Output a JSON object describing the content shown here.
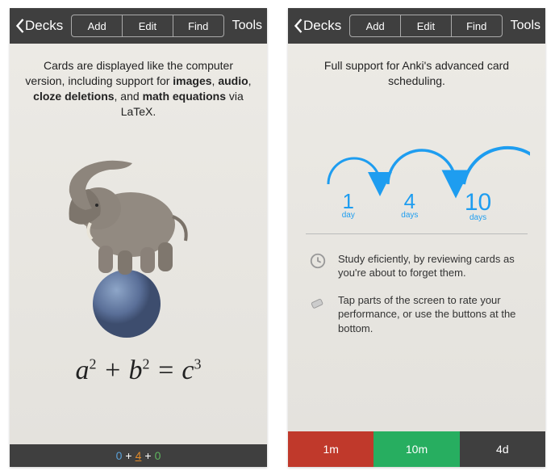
{
  "topbar": {
    "back": "Decks",
    "seg": [
      "Add",
      "Edit",
      "Find"
    ],
    "tools": "Tools"
  },
  "left": {
    "desc_pre": "Cards are displayed like the computer version, including support for ",
    "b1": "images",
    "s1": ", ",
    "b2": "audio",
    "s2": ", ",
    "b3": "cloze deletions",
    "s3": ", and ",
    "b4": "math equations",
    "s4": " via LaTeX.",
    "equation": "a² + b² = c³",
    "counter": {
      "a": "0",
      "plus1": " + ",
      "b": "4",
      "plus2": " + ",
      "c": "0"
    }
  },
  "right": {
    "desc": "Full support for Anki's advanced card scheduling.",
    "nodes": [
      {
        "n": "1",
        "u": "day"
      },
      {
        "n": "4",
        "u": "days"
      },
      {
        "n": "10",
        "u": "days"
      }
    ],
    "tip1": "Study eficiently, by reviewing cards as you're about to forget them.",
    "tip2": "Tap parts of the screen to rate your performance, or use the buttons at the bottom.",
    "rate": [
      "1m",
      "10m",
      "4d"
    ]
  }
}
